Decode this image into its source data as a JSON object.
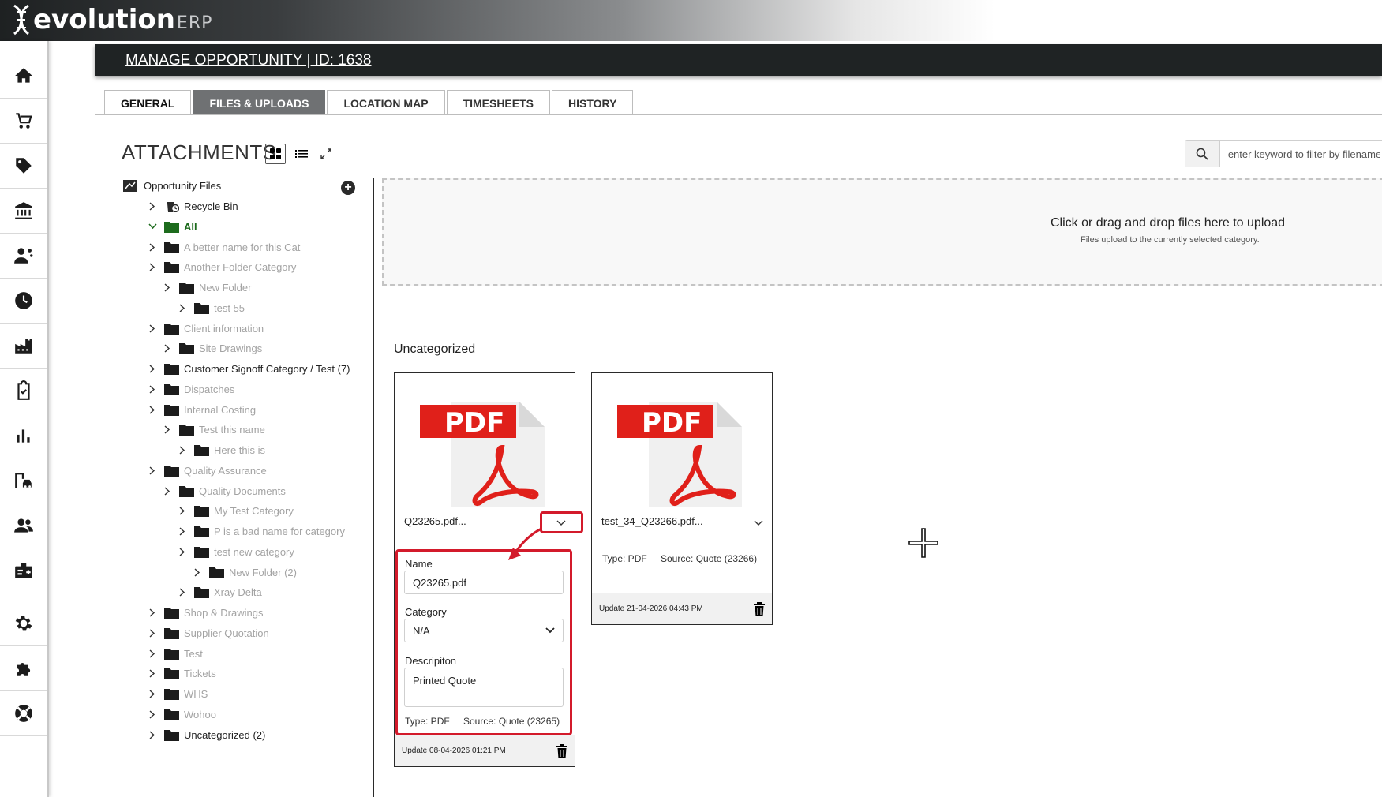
{
  "brand": {
    "name": "evolution",
    "suffix": "ERP"
  },
  "nav": [
    "home-icon",
    "cart-icon",
    "tag-icon",
    "bank-icon",
    "people-money-icon",
    "clock-icon",
    "factory-icon",
    "clipboard-check-icon",
    "bar-chart-icon",
    "building-car-icon",
    "users-icon",
    "id-badge-icon",
    "gear-icon",
    "puzzle-icon",
    "lifebuoy-icon"
  ],
  "header": {
    "title": "MANAGE OPPORTUNITY | ID: 1638"
  },
  "tabs": [
    "GENERAL",
    "FILES & UPLOADS",
    "LOCATION MAP",
    "TIMESHEETS",
    "HISTORY"
  ],
  "active_tab": "FILES & UPLOADS",
  "attachments": {
    "title": "ATTACHMENTS"
  },
  "search": {
    "placeholder": "enter keyword to filter by filename"
  },
  "tree": {
    "root": "Opportunity Files",
    "nodes": [
      {
        "label": "Recycle Bin",
        "depth": 0,
        "style": "dark",
        "icon": "recycle-bin"
      },
      {
        "label": "All",
        "depth": 0,
        "style": "green",
        "icon": "folder-green",
        "expanded": true
      },
      {
        "label": "A better name for this Cat",
        "depth": 0,
        "style": "muted"
      },
      {
        "label": "Another Folder Category",
        "depth": 0,
        "style": "muted"
      },
      {
        "label": "New Folder",
        "depth": 1,
        "style": "muted"
      },
      {
        "label": "test 55",
        "depth": 2,
        "style": "muted"
      },
      {
        "label": "Client information",
        "depth": 0,
        "style": "muted"
      },
      {
        "label": "Site Drawings",
        "depth": 1,
        "style": "muted"
      },
      {
        "label": "Customer Signoff Category / Test (7)",
        "depth": 0,
        "style": "dark"
      },
      {
        "label": "Dispatches",
        "depth": 0,
        "style": "muted"
      },
      {
        "label": "Internal Costing",
        "depth": 0,
        "style": "muted"
      },
      {
        "label": "Test this name",
        "depth": 1,
        "style": "muted"
      },
      {
        "label": "Here this is",
        "depth": 2,
        "style": "muted"
      },
      {
        "label": "Quality Assurance",
        "depth": 0,
        "style": "muted"
      },
      {
        "label": "Quality Documents",
        "depth": 1,
        "style": "muted"
      },
      {
        "label": "My Test Category",
        "depth": 2,
        "style": "muted"
      },
      {
        "label": "P is a bad name for category",
        "depth": 2,
        "style": "muted"
      },
      {
        "label": "test new category",
        "depth": 2,
        "style": "muted"
      },
      {
        "label": "New Folder (2)",
        "depth": 3,
        "style": "muted"
      },
      {
        "label": "Xray Delta",
        "depth": 2,
        "style": "muted"
      },
      {
        "label": "Shop & Drawings",
        "depth": 0,
        "style": "muted"
      },
      {
        "label": "Supplier Quotation",
        "depth": 0,
        "style": "muted"
      },
      {
        "label": "Test",
        "depth": 0,
        "style": "muted"
      },
      {
        "label": "Tickets",
        "depth": 0,
        "style": "muted"
      },
      {
        "label": "WHS",
        "depth": 0,
        "style": "muted"
      },
      {
        "label": "Wohoo",
        "depth": 0,
        "style": "muted"
      },
      {
        "label": "Uncategorized (2)",
        "depth": 0,
        "style": "dark"
      }
    ]
  },
  "dropzone": {
    "title": "Click or drag and drop files here to upload",
    "subtitle": "Files upload to the currently selected category."
  },
  "section": {
    "title": "Uncategorized"
  },
  "files": [
    {
      "filename": "Q23265.pdf...",
      "icon_text": "PDF",
      "expanded": true,
      "name_label": "Name",
      "name_value": "Q23265.pdf",
      "category_label": "Category",
      "category_value": "N/A",
      "description_label": "Descripiton",
      "description_value": "Printed Quote",
      "type": "Type: PDF",
      "source": "Source: Quote (23265)",
      "updated": "Update 08-04-2026 01:21 PM"
    },
    {
      "filename": "test_34_Q23266.pdf...",
      "icon_text": "PDF",
      "expanded": false,
      "type": "Type: PDF",
      "source": "Source: Quote (23266)",
      "updated": "Update 21-04-2026 04:43 PM"
    }
  ],
  "colors": {
    "accent_red": "#d31a2b",
    "pdf_red": "#e0201a",
    "header_dark": "#1f2324",
    "tab_active": "#6f7173",
    "tree_green": "#1d6b1d",
    "tree_muted": "#a3a3a3"
  }
}
